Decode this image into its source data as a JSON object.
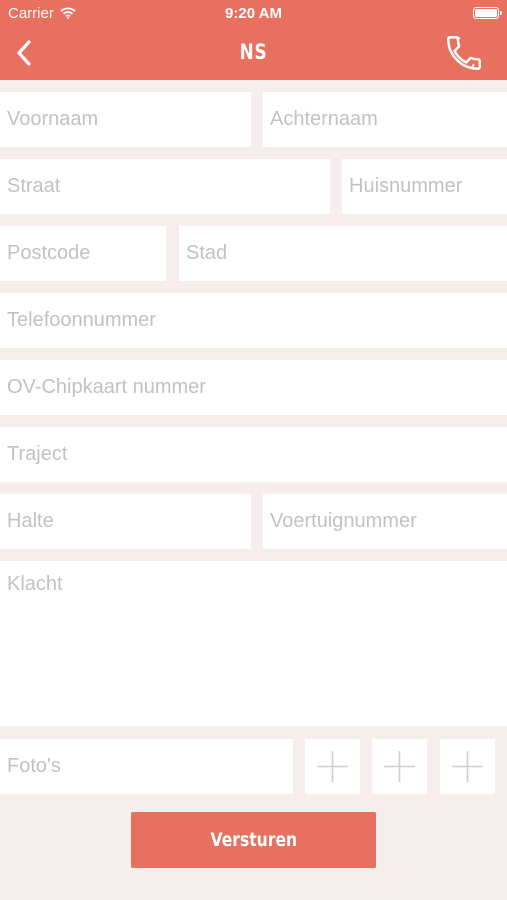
{
  "status_bar": {
    "carrier": "Carrier",
    "time": "9:20 AM",
    "wifi_icon": "wifi-icon",
    "battery_icon": "battery-icon"
  },
  "nav": {
    "title": "NS",
    "back_icon": "chevron-left-icon",
    "phone_icon": "phone-icon"
  },
  "form": {
    "voornaam": "Voornaam",
    "achternaam": "Achternaam",
    "straat": "Straat",
    "huisnummer": "Huisnummer",
    "postcode": "Postcode",
    "stad": "Stad",
    "telefoonnummer": "Telefoonnummer",
    "ov_chipkaart": "OV-Chipkaart nummer",
    "traject": "Traject",
    "halte": "Halte",
    "voertuignummer": "Voertuignummer",
    "klacht": "Klacht"
  },
  "photos": {
    "label": "Foto's",
    "add_icon": "plus-icon",
    "slot_count": 3
  },
  "submit": {
    "label": "Versturen"
  },
  "colors": {
    "accent": "#e8705e",
    "background": "#f5eeec",
    "field": "#ffffff",
    "placeholder": "#c2c2c2"
  }
}
